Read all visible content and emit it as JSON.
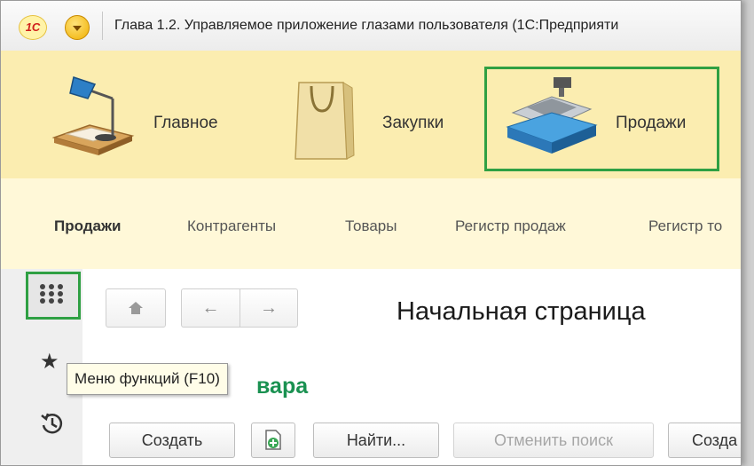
{
  "window": {
    "logo_text": "1С",
    "title": "Глава 1.2. Управляемое приложение глазами пользователя  (1С:Предприяти"
  },
  "sections": [
    {
      "label": "Главное",
      "icon": "desk-lamp-icon"
    },
    {
      "label": "Закупки",
      "icon": "shopping-bag-icon"
    },
    {
      "label": "Продажи",
      "icon": "cash-register-icon",
      "active": true
    }
  ],
  "subnav": {
    "items": [
      "Продажи",
      "Контрагенты",
      "Товары",
      "Регистр продаж",
      "Регистр то"
    ]
  },
  "sidebar": {
    "function_menu_icon": "grid-dots-icon",
    "favorites_icon": "star-icon",
    "history_icon": "history-icon"
  },
  "toolbar": {
    "home_icon": "home-icon",
    "back_icon": "arrow-left-icon",
    "forward_icon": "arrow-right-icon"
  },
  "page": {
    "title": "Начальная страница",
    "form_title_visible": "вара"
  },
  "tooltip": {
    "text": "Меню функций (F10)"
  },
  "commands": {
    "create": "Создать",
    "add_icon": "add-document-icon",
    "find": "Найти...",
    "cancel_search": "Отменить поиск",
    "create2": "Созда"
  },
  "colors": {
    "sections_bg": "#fbedb0",
    "subnav_bg": "#fff8d8",
    "highlight": "#2fa043",
    "form_title": "#1a9151"
  }
}
